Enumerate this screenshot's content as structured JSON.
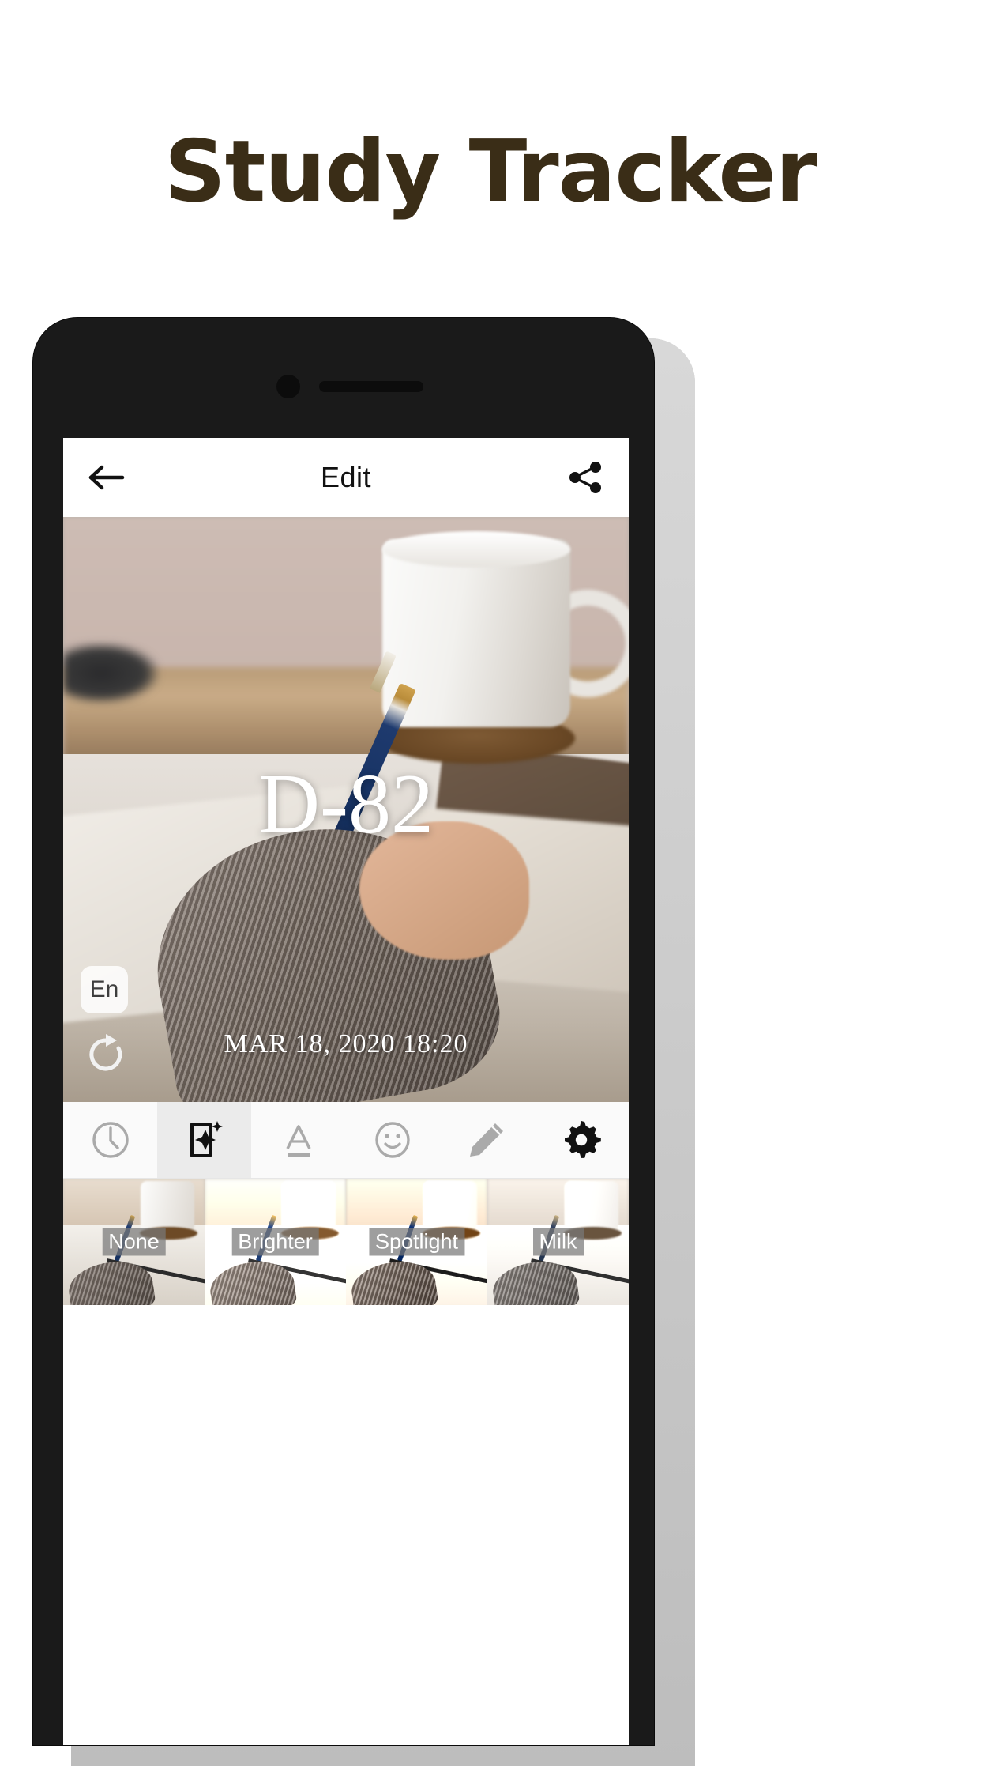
{
  "headline": "Study Tracker",
  "phone": {
    "camera_icon": "front-camera",
    "speaker_icon": "earpiece-speaker"
  },
  "appbar": {
    "back_icon": "back-arrow-icon",
    "title": "Edit",
    "share_icon": "share-icon"
  },
  "photo": {
    "dday_label": "D-82",
    "language_badge": "En",
    "rotate_icon": "rotate-refresh-icon",
    "date_label": "MAR 18, 2020 18:20"
  },
  "toolbar": {
    "items": [
      {
        "name": "clock-icon",
        "label": "Time",
        "selected": false
      },
      {
        "name": "filter-icon",
        "label": "Filter",
        "selected": true
      },
      {
        "name": "text-icon",
        "label": "Text",
        "selected": false
      },
      {
        "name": "sticker-icon",
        "label": "Sticker",
        "selected": false
      },
      {
        "name": "pencil-icon",
        "label": "Draw",
        "selected": false
      }
    ],
    "settings": {
      "name": "gear-icon",
      "label": "Settings"
    }
  },
  "filters": [
    {
      "label": "None"
    },
    {
      "label": "Brighter"
    },
    {
      "label": "Spotlight"
    },
    {
      "label": "Milk"
    }
  ],
  "colors": {
    "headline": "#3a2d17",
    "phone_frame": "#1a1a1a",
    "appbar_bg": "#ffffff",
    "toolbar_bg": "#fafafa",
    "selected_tool_bg": "#ebebeb",
    "icon_inactive": "#aaaaaa",
    "icon_active": "#111111",
    "overlay_text": "#ffffff",
    "filter_label_bg": "rgba(120,120,120,.72)"
  }
}
